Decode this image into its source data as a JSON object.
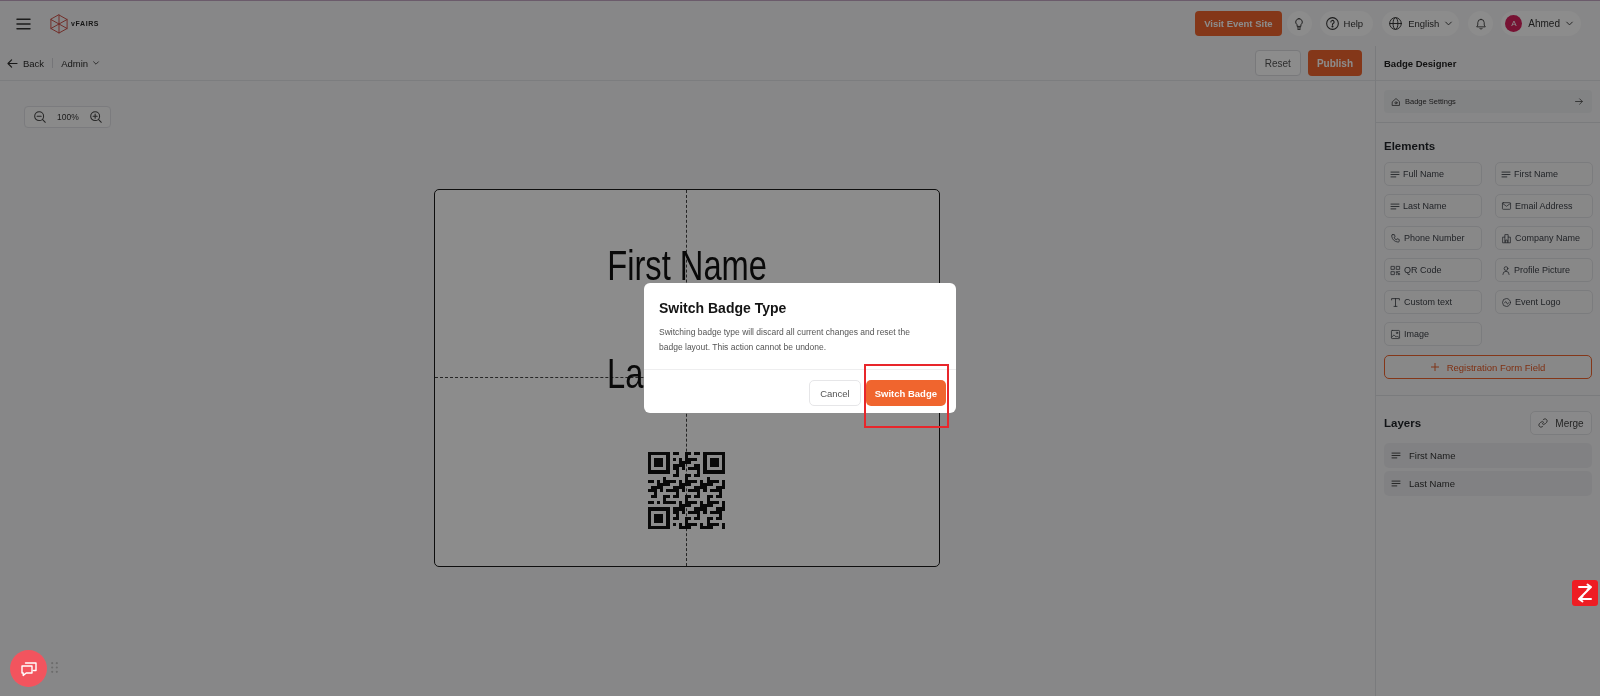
{
  "header": {
    "logo_text": "vFAIRS",
    "visit_button": "Visit Event Site",
    "help_label": "Help",
    "language": "English",
    "user": {
      "initial": "A",
      "name": "Ahmed"
    }
  },
  "toolbar": {
    "back": "Back",
    "workspace": "Admin",
    "reset": "Reset",
    "publish": "Publish"
  },
  "zoom": {
    "value": "100%"
  },
  "badge": {
    "lines": [
      "First Name",
      "La"
    ]
  },
  "panel": {
    "title": "Badge Designer",
    "settings_link": "Badge Settings",
    "elements_title": "Elements",
    "elements": [
      {
        "label": "Full Name",
        "kind": "text"
      },
      {
        "label": "First Name",
        "kind": "text"
      },
      {
        "label": "Last Name",
        "kind": "text"
      },
      {
        "label": "Email Address",
        "kind": "email"
      },
      {
        "label": "Phone Number",
        "kind": "phone"
      },
      {
        "label": "Company Name",
        "kind": "company"
      },
      {
        "label": "QR Code",
        "kind": "qr"
      },
      {
        "label": "Profile Picture",
        "kind": "profile"
      },
      {
        "label": "Custom text",
        "kind": "custom_text"
      },
      {
        "label": "Event Logo",
        "kind": "logo"
      },
      {
        "label": "Image",
        "kind": "image"
      }
    ],
    "add_field_button": "Registration Form Field",
    "layers_title": "Layers",
    "merge_button": "Merge",
    "layers": [
      "First Name",
      "Last Name"
    ]
  },
  "dialog": {
    "title": "Switch Badge Type",
    "message": "Switching badge type will discard all current changes and reset the badge layout. This action cannot be undone.",
    "buttons": [
      {
        "label": "Cancel",
        "kind": "secondary",
        "highlighted": false
      },
      {
        "label": "Switch Badge",
        "kind": "primary",
        "highlighted": true
      }
    ]
  }
}
